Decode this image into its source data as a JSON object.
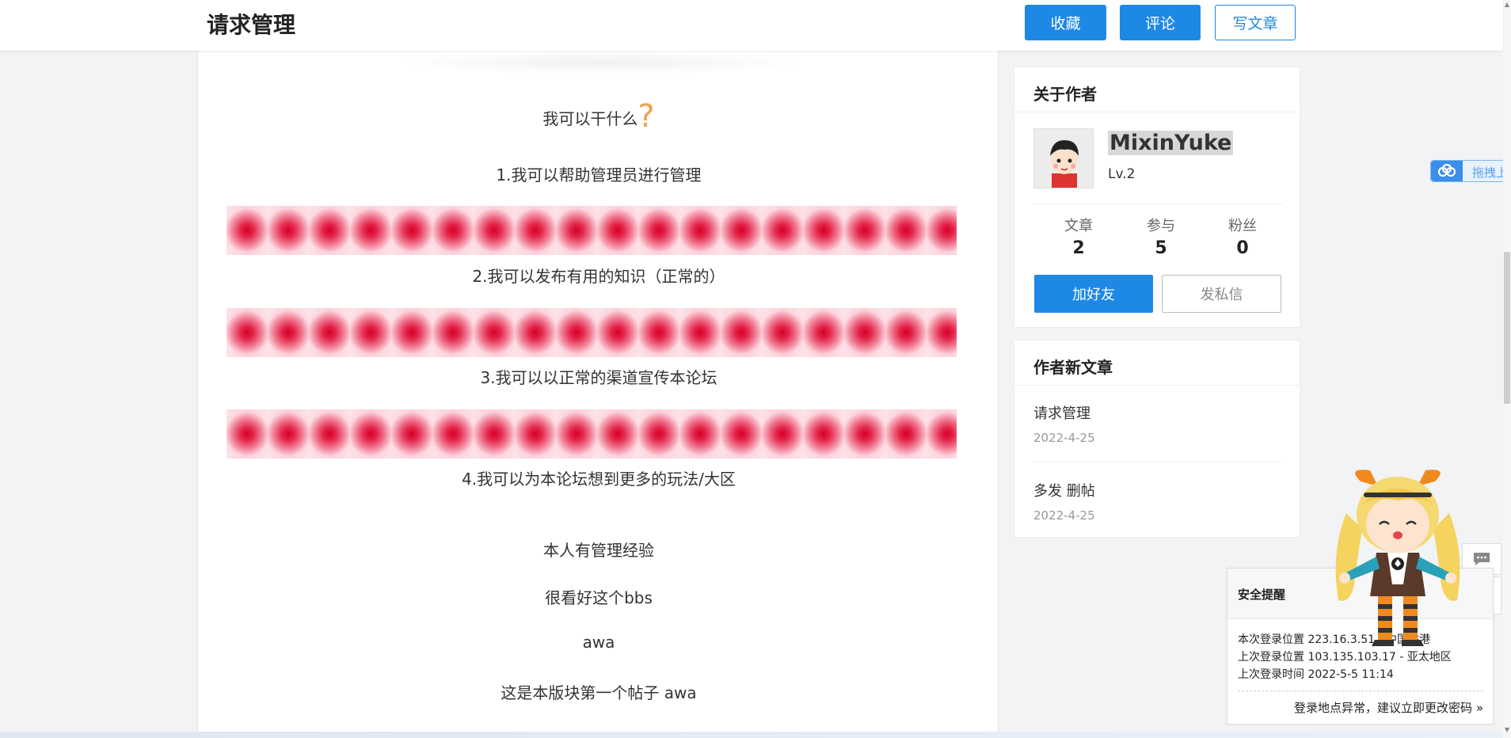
{
  "header": {
    "title": "请求管理",
    "buttons": {
      "favorite": "收藏",
      "comment": "评论",
      "write": "写文章"
    }
  },
  "article": {
    "question": "我可以干什么",
    "question_mark": "?",
    "items": [
      "1.我可以帮助管理员进行管理",
      "2.我可以发布有用的知识（正常的）",
      "3.我可以以正常的渠道宣传本论坛",
      "4.我可以为本论坛想到更多的玩法/大区"
    ],
    "paragraphs": [
      "本人有管理经验",
      "很看好这个bbs",
      "awa",
      "这是本版块第一个帖子 awa"
    ]
  },
  "author_card": {
    "title": "关于作者",
    "name": "MixinYuke",
    "level": "Lv.2",
    "stats": [
      {
        "label": "文章",
        "value": "2"
      },
      {
        "label": "参与",
        "value": "5"
      },
      {
        "label": "粉丝",
        "value": "0"
      }
    ],
    "add_friend": "加好友",
    "send_message": "发私信"
  },
  "new_posts": {
    "title": "作者新文章",
    "posts": [
      {
        "title": "请求管理",
        "date": "2022-4-25"
      },
      {
        "title": "多发 删帖",
        "date": "2022-4-25"
      }
    ]
  },
  "upload_tab": {
    "label": "拖拽上传"
  },
  "security": {
    "title": "安全提醒",
    "lines": [
      "本次登录位置 223.16.3.51 - 中国香港",
      "上次登录位置 103.135.103.17 - 亚太地区",
      "上次登录时间 2022-5-5 11:14"
    ],
    "link": "登录地点异常，建议立即更改密码 »"
  },
  "colors": {
    "primary": "#1e88e5",
    "accent_question": "#f0a050",
    "pattern_red": "#d70026"
  },
  "icons": {
    "chat": "speech-bubble-icon",
    "upload": "cloud-icon"
  }
}
